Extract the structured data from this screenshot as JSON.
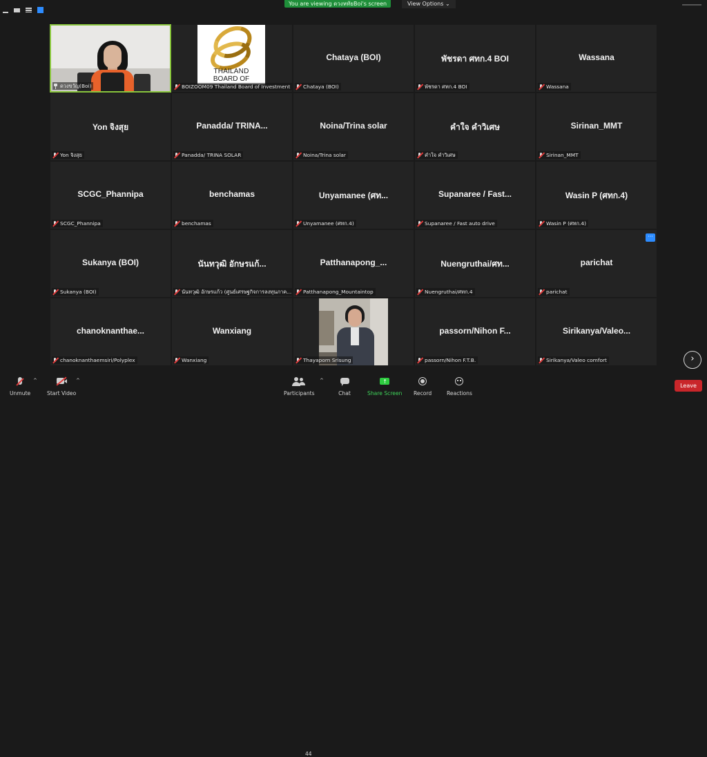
{
  "banner": "You are viewing ดวงหทัยBoi's screen",
  "view_options": "View Options",
  "tiles": [
    {
      "big": "",
      "label": "ดวงขวัญ(Boi)",
      "type": "video1",
      "icon": "pin"
    },
    {
      "big": "",
      "label": "BOIZOOM09 Thailand Board of Investment",
      "type": "logo",
      "icon": "mic-muted"
    },
    {
      "big": "Chataya (BOI)",
      "label": "Chataya (BOI)",
      "icon": "mic-muted"
    },
    {
      "big": "พัชรดา ศทก.4 BOI",
      "label": "พัชรดา ศทก.4 BOI",
      "icon": "mic-muted"
    },
    {
      "big": "Wassana",
      "label": "Wassana",
      "icon": "mic-muted"
    },
    {
      "big": "Yon จิงสุย",
      "label": "Yon จิงสุย",
      "icon": "mic-muted"
    },
    {
      "big": "Panadda/ TRINA...",
      "label": "Panadda/ TRINA SOLAR",
      "icon": "mic-muted"
    },
    {
      "big": "Noina/Trina solar",
      "label": "Noina/Trina solar",
      "icon": "mic-muted"
    },
    {
      "big": "คำใจ คำวิเศษ",
      "label": "คำใจ คำวิเศษ",
      "icon": "mic-muted"
    },
    {
      "big": "Sirinan_MMT",
      "label": "Sirinan_MMT",
      "icon": "mic-muted"
    },
    {
      "big": "SCGC_Phannipa",
      "label": "SCGC_Phannipa",
      "icon": "mic-muted"
    },
    {
      "big": "benchamas",
      "label": "benchamas",
      "icon": "mic-muted"
    },
    {
      "big": "Unyamanee (ศท...",
      "label": "Unyamanee (ศทก.4)",
      "icon": "mic-muted"
    },
    {
      "big": "Supanaree / Fast...",
      "label": "Supanaree / Fast auto drive",
      "icon": "mic-muted"
    },
    {
      "big": "Wasin P (ศทก.4)",
      "label": "Wasin P (ศทก.4)",
      "icon": "mic-muted"
    },
    {
      "big": "Sukanya (BOI)",
      "label": "Sukanya (BOI)",
      "icon": "mic-muted"
    },
    {
      "big": "นันทวุฒิ อักษรแก้...",
      "label": "นันทวุฒิ อักษรแก้ว (ศูนย์เศรษฐกิจการลงทุนภาค...",
      "icon": "mic-muted"
    },
    {
      "big": "Patthanapong_...",
      "label": "Patthanapong_Mountaintop",
      "icon": "mic-muted"
    },
    {
      "big": "Nuengruthai/ศท...",
      "label": "Nuengruthai/ศทก.4",
      "icon": "mic-muted"
    },
    {
      "big": "parichat",
      "label": "parichat",
      "icon": "mic-muted"
    },
    {
      "big": "chanoknanthae...",
      "label": "chanoknanthaemsiri/Polyplex",
      "icon": "mic-muted"
    },
    {
      "big": "Wanxiang",
      "label": "Wanxiang",
      "icon": "mic-muted"
    },
    {
      "big": "",
      "label": "Thayaporn Srisung",
      "type": "video2",
      "icon": "mic-muted"
    },
    {
      "big": "passorn/Nihon F...",
      "label": "passorn/Nihon F.T.B.",
      "icon": "mic-muted"
    },
    {
      "big": "Sirikanya/Valeo...",
      "label": "Sirikanya/Valeo comfort",
      "icon": "mic-muted"
    }
  ],
  "logo_text": [
    "THAILAND",
    "BOARD OF"
  ],
  "more_button": "···",
  "next_page": "›",
  "toolbar": {
    "unmute": "Unmute",
    "start_video": "Start Video",
    "participants": "Participants",
    "participant_count": "44",
    "chat": "Chat",
    "share_screen": "Share Screen",
    "record": "Record",
    "reactions": "Reactions",
    "leave": "Leave"
  }
}
